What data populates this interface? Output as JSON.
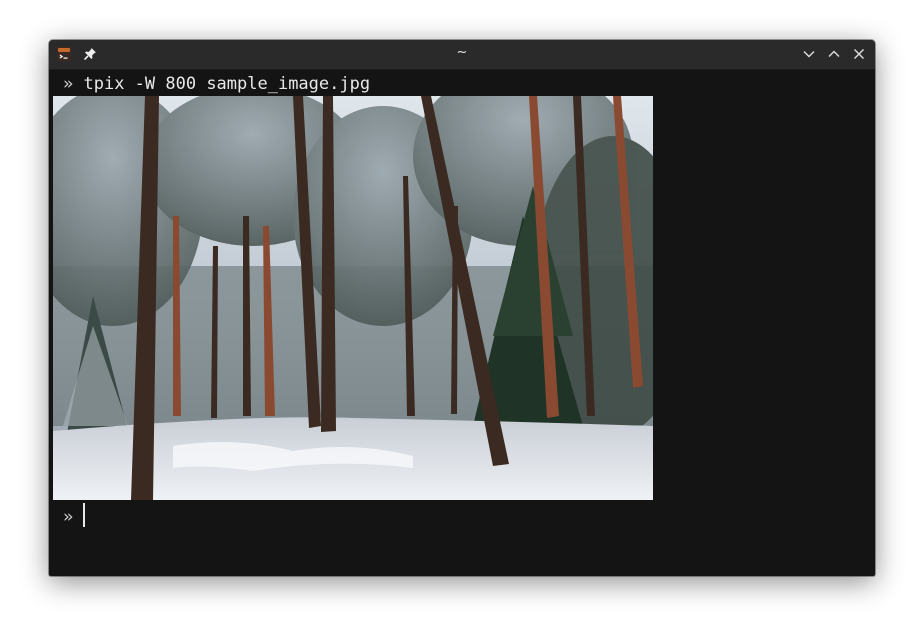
{
  "window": {
    "title": "~"
  },
  "terminal": {
    "prompt_symbol": "»",
    "command": "tpix -W 800 sample_image.jpg",
    "second_prompt_symbol": "»"
  },
  "image": {
    "description_icon": "snowy-forest-image"
  },
  "icons": {
    "app": "terminal-app-icon",
    "pin": "pin-icon",
    "minimize": "chevron-down-icon",
    "maximize": "chevron-up-icon",
    "close": "close-icon"
  }
}
